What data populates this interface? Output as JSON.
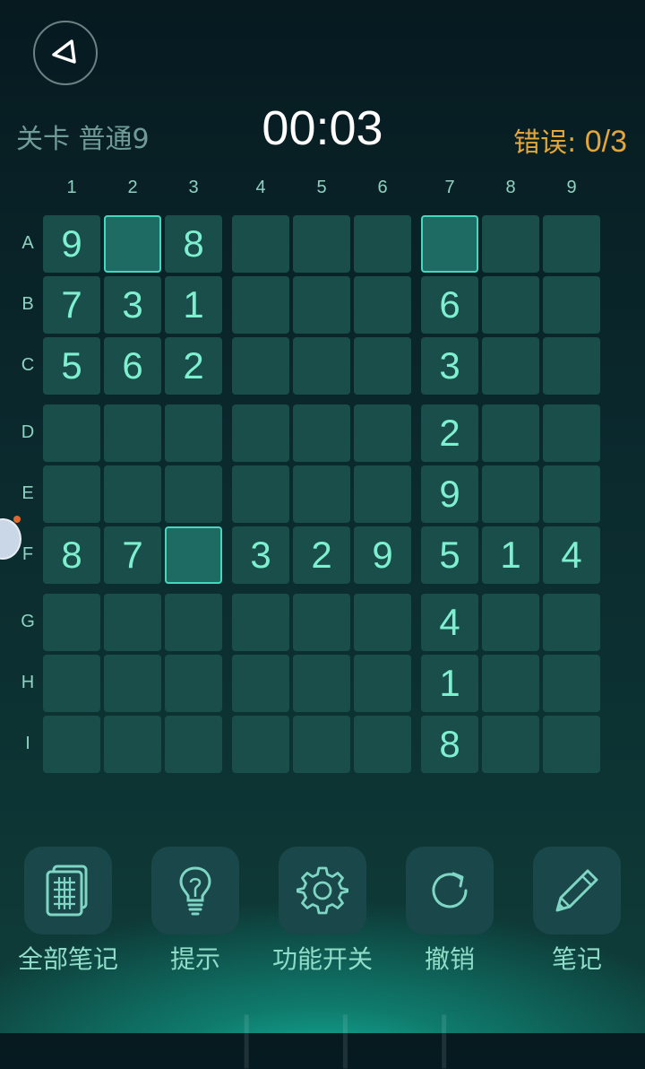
{
  "header": {
    "level_prefix": "关卡",
    "level_name": "普通9",
    "timer": "00:03",
    "errors_label": "错误:",
    "errors_value": "0/3"
  },
  "grid": {
    "col_labels": [
      "1",
      "2",
      "3",
      "4",
      "5",
      "6",
      "7",
      "8",
      "9"
    ],
    "row_labels": [
      "A",
      "B",
      "C",
      "D",
      "E",
      "F",
      "G",
      "H",
      "I"
    ],
    "cells": [
      [
        "9",
        "",
        "8",
        "",
        "",
        "",
        "",
        "",
        ""
      ],
      [
        "7",
        "3",
        "1",
        "",
        "",
        "",
        "6",
        "",
        ""
      ],
      [
        "5",
        "6",
        "2",
        "",
        "",
        "",
        "3",
        "",
        ""
      ],
      [
        "",
        "",
        "",
        "",
        "",
        "",
        "2",
        "",
        ""
      ],
      [
        "",
        "",
        "",
        "",
        "",
        "",
        "9",
        "",
        ""
      ],
      [
        "8",
        "7",
        "",
        "3",
        "2",
        "9",
        "5",
        "1",
        "4"
      ],
      [
        "",
        "",
        "",
        "",
        "",
        "",
        "4",
        "",
        ""
      ],
      [
        "",
        "",
        "",
        "",
        "",
        "",
        "1",
        "",
        ""
      ],
      [
        "",
        "",
        "",
        "",
        "",
        "",
        "8",
        "",
        ""
      ]
    ],
    "selected": [
      [
        0,
        1
      ],
      [
        0,
        6
      ],
      [
        5,
        2
      ]
    ]
  },
  "toolbar": {
    "all_notes": "全部笔记",
    "hint": "提示",
    "settings": "功能开关",
    "undo": "撤销",
    "notes": "笔记"
  },
  "icons": {
    "back": "back-triangle-icon",
    "all_notes": "grid-notes-icon",
    "hint": "lightbulb-icon",
    "settings": "gear-icon",
    "undo": "refresh-icon",
    "notes": "pencil-icon"
  },
  "colors": {
    "timer": "#ffffff",
    "errors": "#e3a63a",
    "digit": "#7ff0cf",
    "cell": "#194e4b",
    "selected_border": "#46d8bf"
  }
}
